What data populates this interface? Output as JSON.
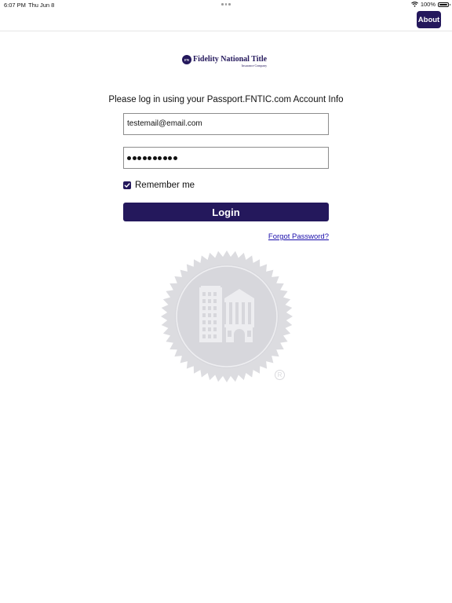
{
  "status_bar": {
    "time": "6:07 PM",
    "date": "Thu Jun 8",
    "battery": "100%",
    "battery_level": 1.0,
    "icons": [
      "wifi-icon",
      "battery-icon"
    ]
  },
  "nav": {
    "about_label": "About"
  },
  "logo": {
    "name": "Fidelity National Title",
    "subtitle": "Insurance Company",
    "badge_text": "FN"
  },
  "login": {
    "instructions": "Please log in using your Passport.FNTIC.com Account Info",
    "email_value": "testemail@email.com",
    "password_masked": "••••••••••",
    "password_length": 10,
    "remember_label": "Remember me",
    "remember_checked": true,
    "login_label": "Login",
    "forgot_label": "Forgot Password?"
  },
  "watermark": {
    "registered_symbol": "R",
    "icon": "seal-building-icon"
  },
  "colors": {
    "brand": "#24185c",
    "link": "#1a0dab",
    "watermark": "#d9d9dd",
    "field_border": "#8d8d8d"
  }
}
